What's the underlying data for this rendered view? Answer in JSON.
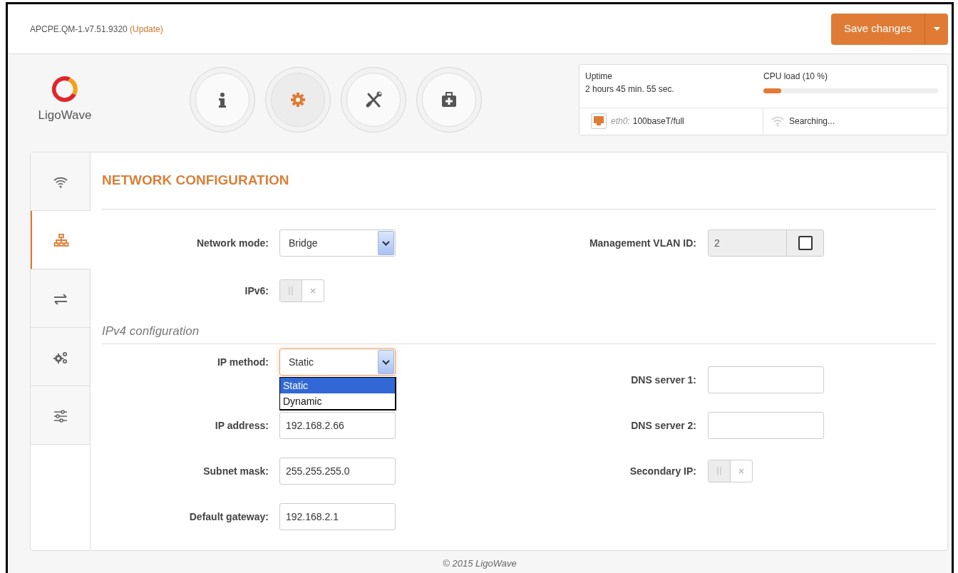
{
  "header": {
    "firmware": "APCPE.QM-1.v7.51.9320",
    "update_link": "(Update)",
    "save_button": "Save changes"
  },
  "logo": {
    "text": "LigoWave"
  },
  "nav_buttons": [
    {
      "kind": "info",
      "selected": false
    },
    {
      "kind": "settings",
      "selected": true
    },
    {
      "kind": "tools",
      "selected": false
    },
    {
      "kind": "medkit",
      "selected": false
    }
  ],
  "status": {
    "uptime_label": "Uptime",
    "uptime_value": "2 hours 45 min. 55 sec.",
    "cpu_load": {
      "label": "CPU load (10 %)",
      "level": 0.1
    },
    "ethernet": {
      "interface": "eth0:",
      "value": "100baseT/full"
    },
    "wireless": {
      "value": "Searching..."
    }
  },
  "sidebar": {
    "items": [
      {
        "kind": "wifi",
        "selected": false
      },
      {
        "kind": "network",
        "selected": true
      },
      {
        "kind": "arrows",
        "selected": false
      },
      {
        "kind": "gears",
        "selected": false
      },
      {
        "kind": "sliders",
        "selected": false
      }
    ]
  },
  "section_title": "NETWORK CONFIGURATION",
  "general": {
    "left": [
      {
        "kind": "select",
        "label": "Network mode:",
        "value": "Bridge",
        "expanded": false
      },
      {
        "kind": "toggle",
        "label": "IPv6:",
        "on": false
      }
    ],
    "right": [
      {
        "kind": "vlan",
        "label": "Management VLAN ID:",
        "value": "2",
        "disabled": true,
        "checked": false
      }
    ]
  },
  "ipv4": {
    "title": "IPv4 configuration",
    "left": [
      {
        "kind": "select",
        "label": "IP method:",
        "value": "Static",
        "expanded": true,
        "options": [
          {
            "label": "Static",
            "selected": true
          },
          {
            "label": "Dynamic",
            "selected": false
          }
        ]
      },
      {
        "kind": "input",
        "label": "IP address:",
        "value": "192.168.2.66"
      },
      {
        "kind": "input",
        "label": "Subnet mask:",
        "value": "255.255.255.0"
      },
      {
        "kind": "input",
        "label": "Default gateway:",
        "value": "192.168.2.1"
      }
    ],
    "right": [
      {
        "kind": "input",
        "label": "DNS server 1:"
      },
      {
        "kind": "input",
        "label": "DNS server 2:"
      },
      {
        "kind": "toggle",
        "label": "Secondary IP:",
        "on": false
      }
    ]
  },
  "footer": "© 2015 LigoWave"
}
